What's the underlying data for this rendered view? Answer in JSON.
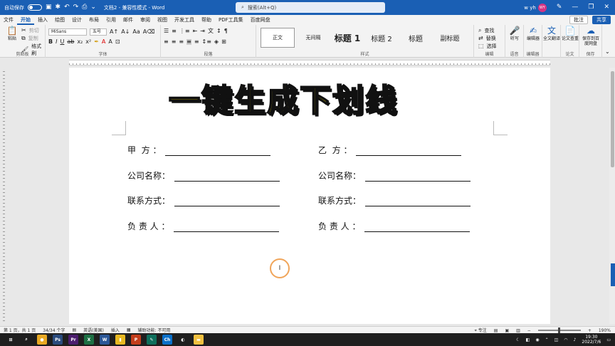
{
  "titlebar": {
    "autosave_label": "自动保存",
    "toggle_state": "关",
    "doc_title": "文档2 - 兼容性模式 - Word",
    "search_placeholder": "搜索(Alt+Q)",
    "user_name": "w yh",
    "user_initials": "WY"
  },
  "menu": {
    "tabs": [
      "文件",
      "开始",
      "插入",
      "绘图",
      "设计",
      "布局",
      "引用",
      "邮件",
      "审阅",
      "视图",
      "开发工具",
      "帮助",
      "PDF工具集",
      "百度网盘"
    ],
    "active_tab": "开始",
    "comments_label": "批注",
    "share_label": "共享"
  },
  "ribbon": {
    "clipboard": {
      "paste": "粘贴",
      "cut": "剪切",
      "copy": "复制",
      "format_painter": "格式刷",
      "label": "剪贴板"
    },
    "font": {
      "font_name": "MiSans",
      "font_size": "五号",
      "label": "字体"
    },
    "paragraph": {
      "label": "段落"
    },
    "styles": {
      "items": [
        "正文",
        "无间隔",
        "标题 1",
        "标题 2",
        "标题",
        "副标题"
      ],
      "selected": "正文",
      "label": "样式"
    },
    "editing": {
      "find": "查找",
      "replace": "替换",
      "select": "选择",
      "label": "编辑"
    },
    "voice": {
      "dictate": "听写",
      "label": "语音"
    },
    "editor": {
      "name": "编辑器",
      "label": "编辑器"
    },
    "translate": {
      "name": "全文翻译",
      "label": "论文"
    },
    "paper": {
      "name": "论文查重"
    },
    "save": {
      "name": "保存到百度网盘",
      "label": "保存"
    }
  },
  "document": {
    "overlay_title": "一键生成下划线",
    "fields_left": [
      "甲  方 ：",
      "公司名称：",
      "联系方式：",
      "负 责 人 ："
    ],
    "fields_right": [
      "乙  方 ：",
      "公司名称：",
      "联系方式：",
      "负 责 人 ："
    ]
  },
  "statusbar": {
    "page": "第 1 页，共 1 页",
    "words": "34/34 个字",
    "language": "英语(美国)",
    "insert_mode": "插入",
    "accessibility": "辅助功能: 不可用",
    "focus": "专注",
    "zoom": "190%"
  },
  "taskbar": {
    "time": "19:30",
    "date": "2022/7/6",
    "apps": [
      {
        "name": "start",
        "color": "#1f1f1f",
        "glyph": "⊞"
      },
      {
        "name": "search",
        "color": "#1f1f1f",
        "glyph": "⌕"
      },
      {
        "name": "chrome",
        "color": "#e9a923",
        "glyph": "●"
      },
      {
        "name": "photoshop",
        "color": "#2b4c7e",
        "glyph": "Ps"
      },
      {
        "name": "premiere",
        "color": "#4b1d6d",
        "glyph": "Pr"
      },
      {
        "name": "excel",
        "color": "#1d7044",
        "glyph": "X"
      },
      {
        "name": "word",
        "color": "#2b5797",
        "glyph": "W"
      },
      {
        "name": "files",
        "color": "#e8b923",
        "glyph": "▮"
      },
      {
        "name": "powerpoint",
        "color": "#c43e1c",
        "glyph": "P"
      },
      {
        "name": "app-green",
        "color": "#0f6f5c",
        "glyph": "✎"
      },
      {
        "name": "app-blue",
        "color": "#0b70c9",
        "glyph": "Ch"
      },
      {
        "name": "app-chat",
        "color": "#1f1f1f",
        "glyph": "◐"
      },
      {
        "name": "explorer",
        "color": "#f0c040",
        "glyph": "▬"
      }
    ]
  },
  "colors": {
    "brand": "#1a5fb4",
    "title_yellow": "#ffe600"
  }
}
